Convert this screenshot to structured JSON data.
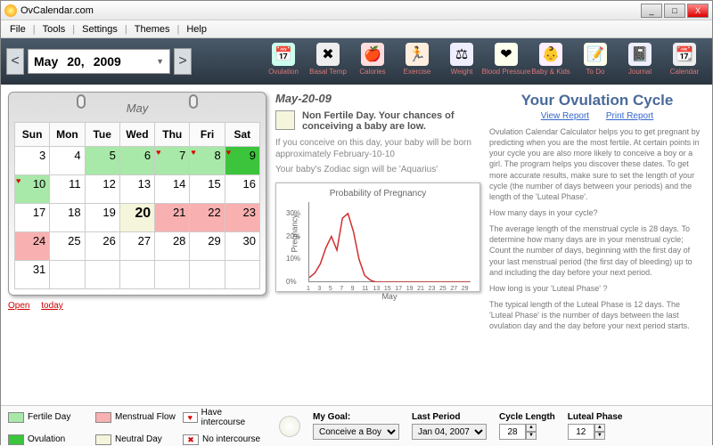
{
  "window": {
    "title": "OvCalendar.com",
    "min": "_",
    "max": "□",
    "close": "X"
  },
  "menu": {
    "file": "File",
    "tools": "Tools",
    "settings": "Settings",
    "themes": "Themes",
    "help": "Help"
  },
  "nav": {
    "prev": "<",
    "next": ">",
    "month": "May",
    "day": "20,",
    "year": "2009"
  },
  "toolbar": [
    {
      "id": "ovulation",
      "label": "Ovulation",
      "glyph": "📅",
      "bg": "#cfe"
    },
    {
      "id": "basal",
      "label": "Basal Temp",
      "glyph": "✖",
      "bg": "#eee"
    },
    {
      "id": "calories",
      "label": "Calories",
      "glyph": "🍎",
      "bg": "#fdd"
    },
    {
      "id": "exercise",
      "label": "Exercise",
      "glyph": "🏃",
      "bg": "#fed"
    },
    {
      "id": "weight",
      "label": "Weight",
      "glyph": "⚖",
      "bg": "#eef"
    },
    {
      "id": "bp",
      "label": "Blood Pressure",
      "glyph": "❤",
      "bg": "#ffe"
    },
    {
      "id": "baby",
      "label": "Baby & Kids",
      "glyph": "👶",
      "bg": "#fef"
    },
    {
      "id": "todo",
      "label": "To Do",
      "glyph": "📝",
      "bg": "#ffe"
    },
    {
      "id": "journal",
      "label": "Journal",
      "glyph": "📓",
      "bg": "#eef"
    },
    {
      "id": "calendar",
      "label": "Calendar",
      "glyph": "📆",
      "bg": "#eee"
    }
  ],
  "cal": {
    "month": "May",
    "dow": [
      "Sun",
      "Mon",
      "Tue",
      "Wed",
      "Thu",
      "Fri",
      "Sat"
    ],
    "weeks": [
      [
        {
          "d": 3,
          "c": ""
        },
        {
          "d": 4,
          "c": ""
        },
        {
          "d": 5,
          "c": "fert"
        },
        {
          "d": 6,
          "c": "fert"
        },
        {
          "d": 7,
          "c": "fert",
          "h": 1
        },
        {
          "d": 8,
          "c": "fert",
          "h": 1
        },
        {
          "d": 9,
          "c": "ovul",
          "h": 1
        }
      ],
      [
        {
          "d": 10,
          "c": "fert",
          "h": 1
        },
        {
          "d": 11,
          "c": ""
        },
        {
          "d": 12,
          "c": ""
        },
        {
          "d": 13,
          "c": ""
        },
        {
          "d": 14,
          "c": ""
        },
        {
          "d": 15,
          "c": ""
        },
        {
          "d": 16,
          "c": ""
        }
      ],
      [
        {
          "d": 17,
          "c": ""
        },
        {
          "d": 18,
          "c": ""
        },
        {
          "d": 19,
          "c": ""
        },
        {
          "d": 20,
          "c": "neut",
          "t": 1
        },
        {
          "d": 21,
          "c": "mens"
        },
        {
          "d": 22,
          "c": "mens"
        },
        {
          "d": 23,
          "c": "mens"
        }
      ],
      [
        {
          "d": 24,
          "c": "mens"
        },
        {
          "d": 25,
          "c": ""
        },
        {
          "d": 26,
          "c": ""
        },
        {
          "d": 27,
          "c": ""
        },
        {
          "d": 28,
          "c": ""
        },
        {
          "d": 29,
          "c": ""
        },
        {
          "d": 30,
          "c": ""
        }
      ],
      [
        {
          "d": 31,
          "c": ""
        },
        {
          "d": "",
          "c": ""
        },
        {
          "d": "",
          "c": ""
        },
        {
          "d": "",
          "c": ""
        },
        {
          "d": "",
          "c": ""
        },
        {
          "d": "",
          "c": ""
        },
        {
          "d": "",
          "c": ""
        }
      ]
    ],
    "open": "Open",
    "today": "today"
  },
  "day": {
    "heading": "May-20-09",
    "title": "Non Fertile Day. Your chances of conceiving a baby are low.",
    "line1": "If you conceive on this day, your baby will be born approximately February-10-10",
    "line2": "Your baby's Zodiac sign will be 'Aquarius'"
  },
  "chart_data": {
    "type": "line",
    "title": "Probability of Pregnancy",
    "xlabel": "May",
    "ylabel": "Pregnancy",
    "x": [
      1,
      2,
      3,
      4,
      5,
      6,
      7,
      8,
      9,
      10,
      11,
      12,
      13,
      14,
      15,
      16,
      17,
      18,
      19,
      20,
      21,
      22,
      23,
      24,
      25,
      26,
      27,
      28,
      29,
      30
    ],
    "values": [
      2,
      4,
      8,
      15,
      20,
      14,
      28,
      30,
      22,
      10,
      3,
      1,
      0,
      0,
      0,
      0,
      0,
      0,
      0,
      0,
      0,
      0,
      0,
      0,
      0,
      0,
      0,
      0,
      0,
      0
    ],
    "yticks": [
      0,
      10,
      20,
      30
    ],
    "ylim": [
      0,
      35
    ],
    "color": "#d03030"
  },
  "info": {
    "title": "Your Ovulation Cycle",
    "view": "View Report",
    "print": "Print Report",
    "p1": "Ovulation Calendar Calculator helps you to get pregnant by predicting when you are the most fertile. At certain points in your cycle you are also more likely to conceive a boy or a girl. The program helps you discover these dates. To get more accurate results, make sure to set the length of your cycle (the number of days between your periods) and the length of the 'Luteal Phase'.",
    "q1": "How many days in your cycle?",
    "p2": "The average length of the menstrual cycle is 28 days. To determine how many days are in your menstrual cycle; Count the number of days, beginning with the first day of your last menstrual period (the first day of bleeding) up to and including the day before your next period.",
    "q2": "How long is your 'Luteal Phase' ?",
    "p3": "The typical length of the Luteal Phase is 12 days. The 'Luteal Phase' is the number of days between the last ovulation day and the day before your next period starts."
  },
  "legend": {
    "fertile": "Fertile Day",
    "menstrual": "Menstrual Flow",
    "intercourse": "Have intercourse",
    "ovulation": "Ovulation",
    "neutral": "Neutral Day",
    "nointercourse": "No intercourse"
  },
  "footer": {
    "goal_label": "My Goal:",
    "goal_value": "Conceive a Boy",
    "period_label": "Last Period",
    "period_value": "Jan 04, 2007",
    "cycle_label": "Cycle Length",
    "cycle_value": "28",
    "luteal_label": "Luteal Phase",
    "luteal_value": "12"
  }
}
